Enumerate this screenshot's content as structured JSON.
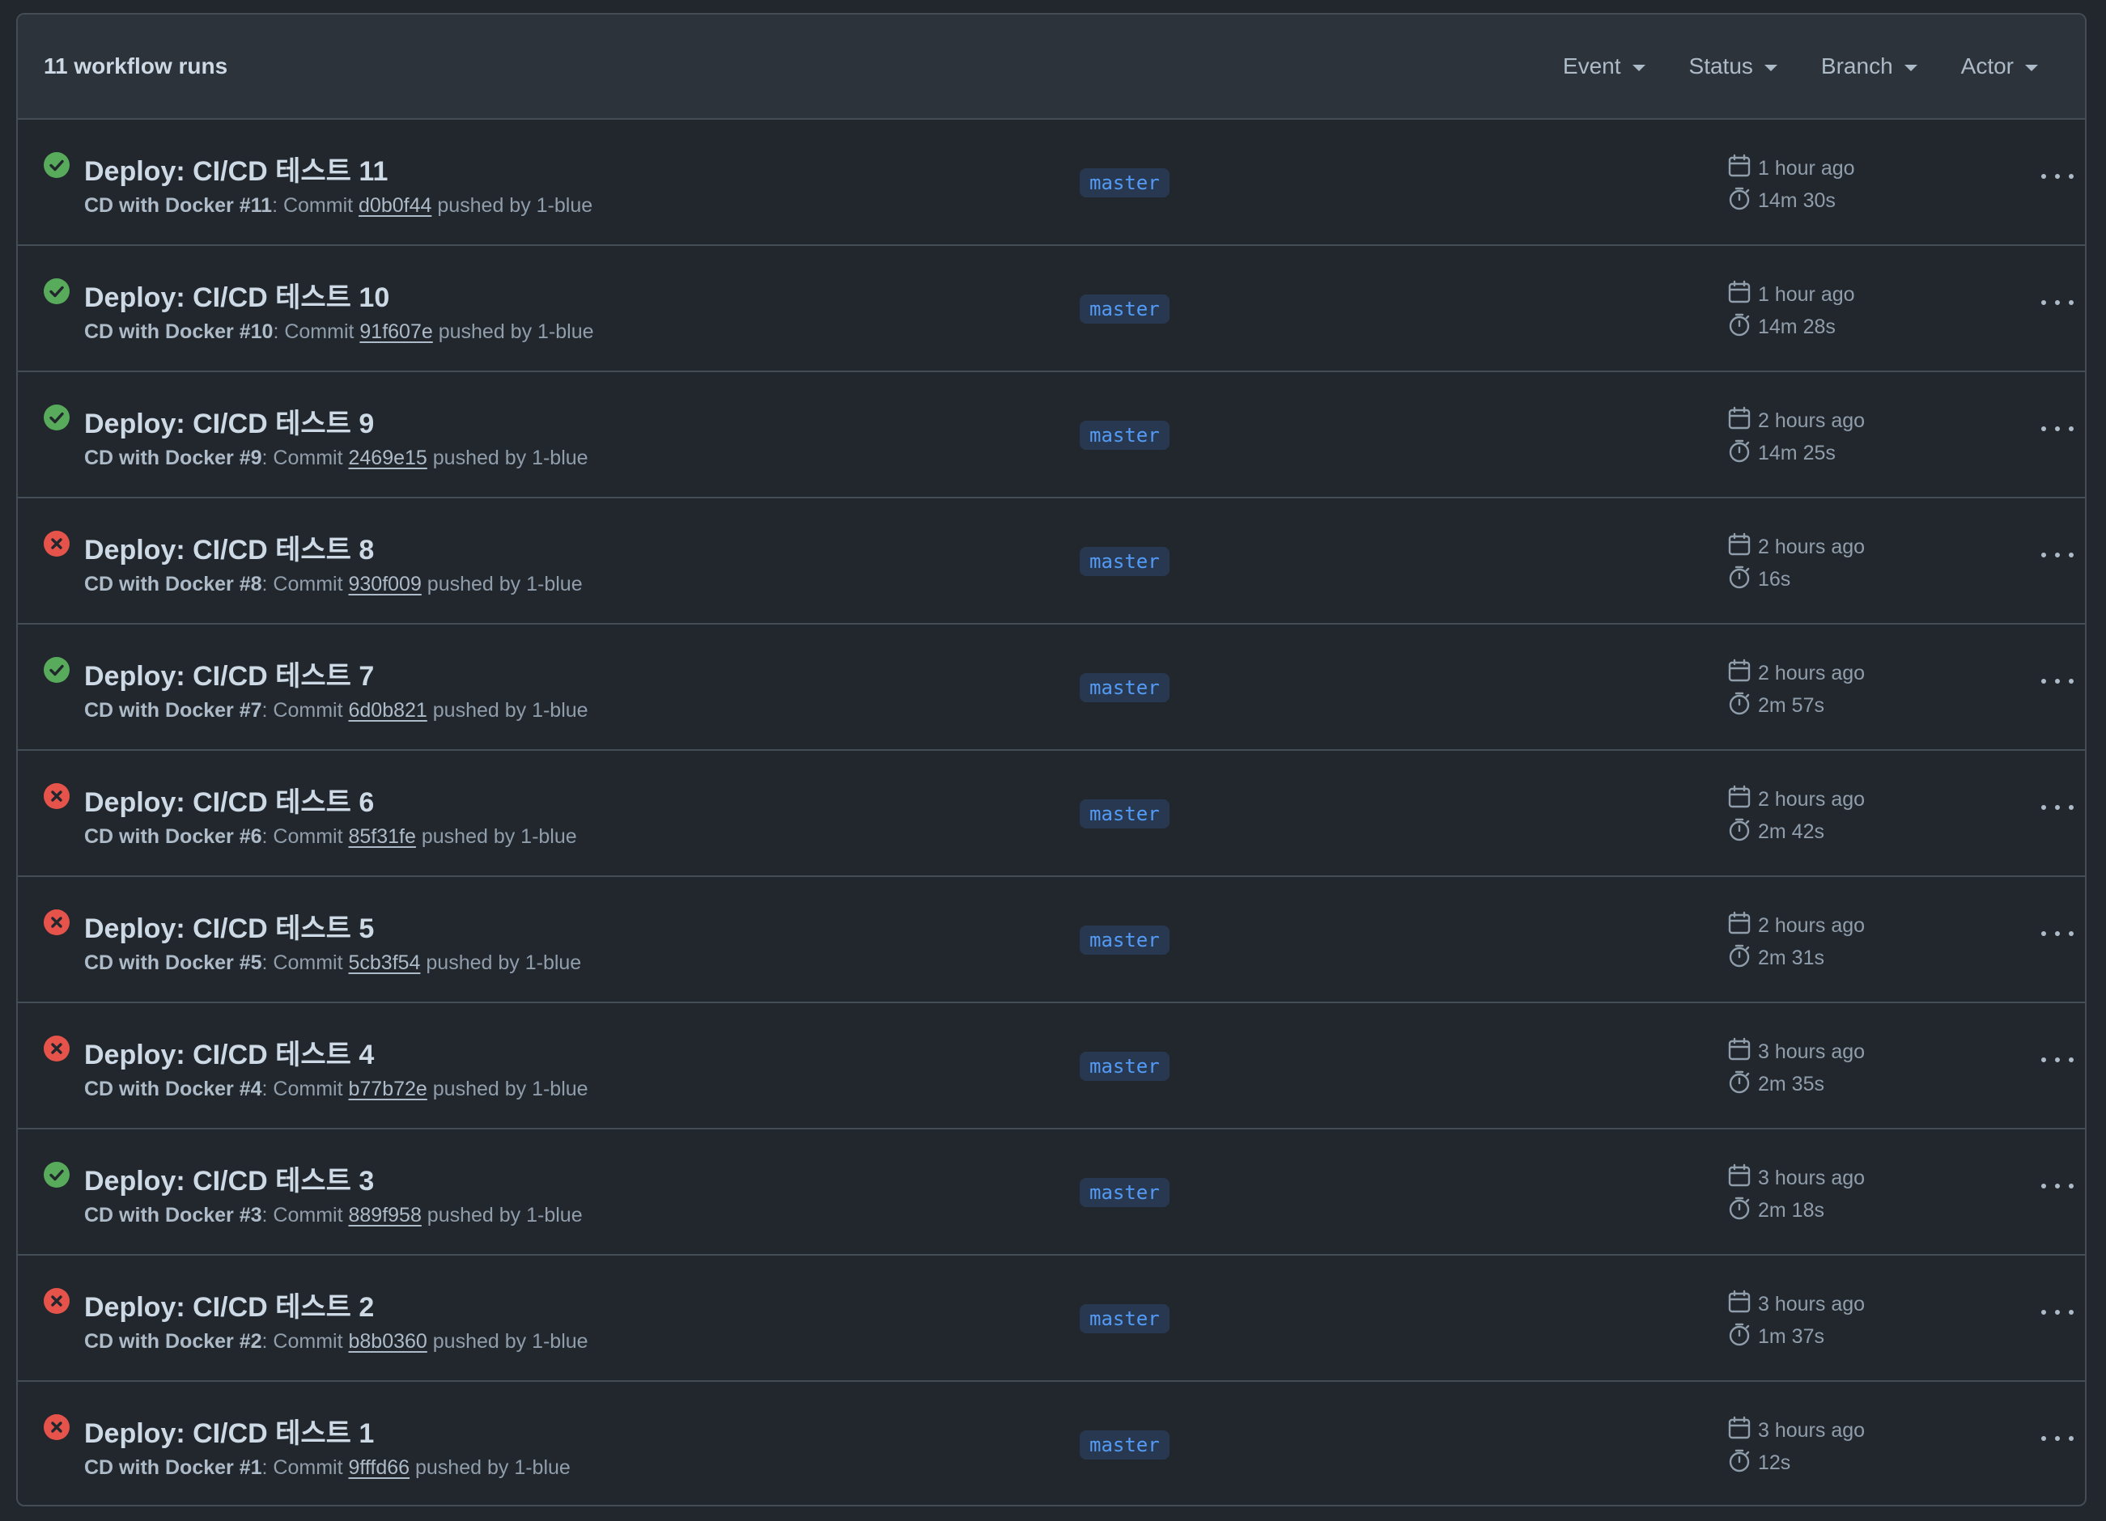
{
  "header": {
    "run_count": "11 workflow runs",
    "filters": [
      "Event",
      "Status",
      "Branch",
      "Actor"
    ]
  },
  "colors": {
    "success": "#57ab5a",
    "failure": "#e5534b",
    "branch_text": "#539bf5"
  },
  "runs": [
    {
      "status": "success",
      "title": "Deploy: CI/CD 테스트 11",
      "workflow": "CD with Docker",
      "number": "#11",
      "sha": "d0b0f44",
      "actor": "1-blue",
      "branch": "master",
      "time": "1 hour ago",
      "duration": "14m 30s"
    },
    {
      "status": "success",
      "title": "Deploy: CI/CD 테스트 10",
      "workflow": "CD with Docker",
      "number": "#10",
      "sha": "91f607e",
      "actor": "1-blue",
      "branch": "master",
      "time": "1 hour ago",
      "duration": "14m 28s"
    },
    {
      "status": "success",
      "title": "Deploy: CI/CD 테스트 9",
      "workflow": "CD with Docker",
      "number": "#9",
      "sha": "2469e15",
      "actor": "1-blue",
      "branch": "master",
      "time": "2 hours ago",
      "duration": "14m 25s"
    },
    {
      "status": "failure",
      "title": "Deploy: CI/CD 테스트 8",
      "workflow": "CD with Docker",
      "number": "#8",
      "sha": "930f009",
      "actor": "1-blue",
      "branch": "master",
      "time": "2 hours ago",
      "duration": "16s"
    },
    {
      "status": "success",
      "title": "Deploy: CI/CD 테스트 7",
      "workflow": "CD with Docker",
      "number": "#7",
      "sha": "6d0b821",
      "actor": "1-blue",
      "branch": "master",
      "time": "2 hours ago",
      "duration": "2m 57s"
    },
    {
      "status": "failure",
      "title": "Deploy: CI/CD 테스트 6",
      "workflow": "CD with Docker",
      "number": "#6",
      "sha": "85f31fe",
      "actor": "1-blue",
      "branch": "master",
      "time": "2 hours ago",
      "duration": "2m 42s"
    },
    {
      "status": "failure",
      "title": "Deploy: CI/CD 테스트 5",
      "workflow": "CD with Docker",
      "number": "#5",
      "sha": "5cb3f54",
      "actor": "1-blue",
      "branch": "master",
      "time": "2 hours ago",
      "duration": "2m 31s"
    },
    {
      "status": "failure",
      "title": "Deploy: CI/CD 테스트 4",
      "workflow": "CD with Docker",
      "number": "#4",
      "sha": "b77b72e",
      "actor": "1-blue",
      "branch": "master",
      "time": "3 hours ago",
      "duration": "2m 35s"
    },
    {
      "status": "success",
      "title": "Deploy: CI/CD 테스트 3",
      "workflow": "CD with Docker",
      "number": "#3",
      "sha": "889f958",
      "actor": "1-blue",
      "branch": "master",
      "time": "3 hours ago",
      "duration": "2m 18s"
    },
    {
      "status": "failure",
      "title": "Deploy: CI/CD 테스트 2",
      "workflow": "CD with Docker",
      "number": "#2",
      "sha": "b8b0360",
      "actor": "1-blue",
      "branch": "master",
      "time": "3 hours ago",
      "duration": "1m 37s"
    },
    {
      "status": "failure",
      "title": "Deploy: CI/CD 테스트 1",
      "workflow": "CD with Docker",
      "number": "#1",
      "sha": "9fffd66",
      "actor": "1-blue",
      "branch": "master",
      "time": "3 hours ago",
      "duration": "12s"
    }
  ]
}
